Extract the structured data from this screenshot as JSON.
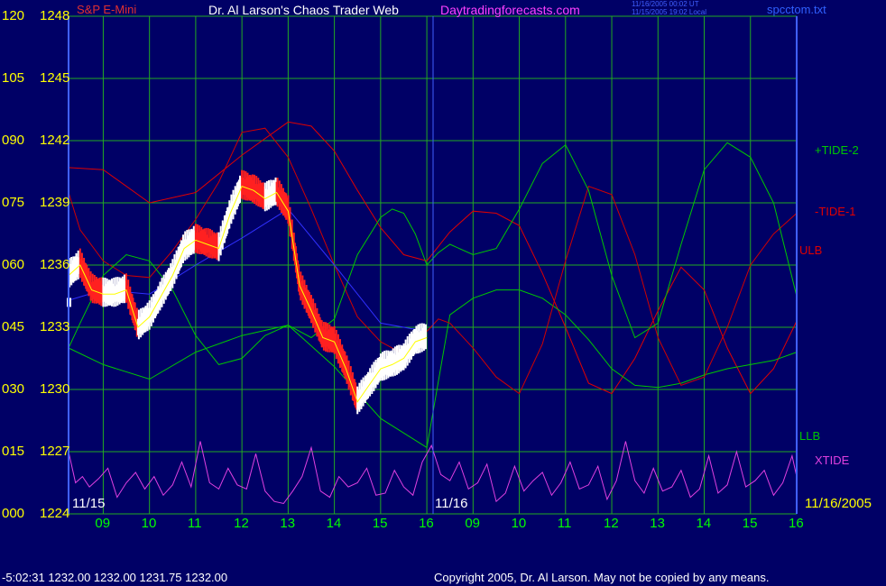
{
  "header": {
    "symbol": "S&P E-Mini",
    "title": "Dr. Al Larson's Chaos Trader Web",
    "site": "Daytradingforecasts.com",
    "stamp_line1": "11/16/2005 00:02 UT",
    "stamp_line2": "11/15/2005 19:02 Local",
    "file": "spcctom.txt"
  },
  "footer": {
    "readout": "-5:02:31  1232.00 1232.00 1231.75 1232.00",
    "copyright": "Copyright 2005, Dr. Al Larson. May not be copied by any means."
  },
  "colors": {
    "background": "#000066",
    "grid": "#22AA22",
    "axis_labels": "#FFFF00",
    "hour_labels": "#00FF00",
    "tide_plus": "#00C800",
    "tide_minus": "#D00000",
    "ulb": "#E00000",
    "llb": "#00C800",
    "xtide": "#E040E0",
    "moving_avg": "#3030FF",
    "price_up": "#FFFFFF",
    "price_down": "#FF2020",
    "price_line": "#FFFF00"
  },
  "chart_data": {
    "type": "line",
    "y_axis": {
      "range": [
        1224,
        1248
      ],
      "ticks": [
        {
          "left": "120",
          "right": "1248",
          "value": 1248
        },
        {
          "left": "105",
          "right": "1245",
          "value": 1245
        },
        {
          "left": "090",
          "right": "1242",
          "value": 1242
        },
        {
          "left": "075",
          "right": "1239",
          "value": 1239
        },
        {
          "left": "060",
          "right": "1236",
          "value": 1236
        },
        {
          "left": "045",
          "right": "1233",
          "value": 1233
        },
        {
          "left": "030",
          "right": "1230",
          "value": 1230
        },
        {
          "left": "015",
          "right": "1227",
          "value": 1227
        },
        {
          "left": "000",
          "right": "1224",
          "value": 1224
        }
      ]
    },
    "x_axis": {
      "hour_ticks": [
        "09",
        "10",
        "11",
        "12",
        "13",
        "14",
        "15",
        "16",
        "09",
        "10",
        "11",
        "12",
        "13",
        "14",
        "15",
        "16"
      ],
      "date_labels": [
        "11/15",
        "11/16",
        "11/16/2005"
      ]
    },
    "series_labels": [
      {
        "id": "tide_plus",
        "label": "+TIDE-2"
      },
      {
        "id": "tide_minus",
        "label": "-TIDE-1"
      },
      {
        "id": "ulb",
        "label": "ULB"
      },
      {
        "id": "llb",
        "label": "LLB"
      },
      {
        "id": "xtide",
        "label": "XTIDE"
      }
    ],
    "price": {
      "x": [
        8.25,
        8.5,
        8.75,
        9,
        9.25,
        9.5,
        9.75,
        10,
        10.25,
        10.5,
        10.75,
        11,
        11.25,
        11.5,
        11.75,
        12,
        12.25,
        12.5,
        12.75,
        13,
        13.25,
        13.5,
        13.75,
        14,
        14.25,
        14.5,
        14.75,
        15,
        15.25,
        15.5,
        15.75,
        16
      ],
      "y": [
        1235.5,
        1236,
        1234.8,
        1234.6,
        1234.6,
        1234.8,
        1233,
        1233.5,
        1234.5,
        1235.5,
        1236.8,
        1237.2,
        1237,
        1236.8,
        1238.5,
        1239.8,
        1239.6,
        1239.2,
        1239.5,
        1238.6,
        1235,
        1233.8,
        1232.5,
        1232.3,
        1231,
        1229.4,
        1230.2,
        1231,
        1231.2,
        1231.5,
        1232.3,
        1232.5
      ]
    },
    "moving_average": {
      "x": [
        8.25,
        9,
        10,
        11,
        12,
        13,
        14,
        15,
        16
      ],
      "y": [
        1234.3,
        1234.8,
        1234.6,
        1236,
        1237.3,
        1238.7,
        1236,
        1233.2,
        1232.8
      ]
    },
    "ulb": {
      "x": [
        8.25,
        9,
        10,
        11,
        12,
        13,
        13.5,
        14,
        14.5,
        15,
        15.5,
        16,
        16.5,
        17,
        17.5,
        18,
        18.5,
        19,
        19.5,
        20,
        20.5,
        21,
        21.5,
        22,
        22.5,
        23,
        23.5,
        24
      ],
      "y": [
        1240.7,
        1240.6,
        1239,
        1239.5,
        1241.3,
        1242.9,
        1242.7,
        1241.5,
        1239.6,
        1237.8,
        1236.5,
        1236.2,
        1237.6,
        1238.6,
        1238.5,
        1237.9,
        1235.6,
        1233,
        1230.3,
        1229.8,
        1231.5,
        1233.8,
        1235.9,
        1234.8,
        1232,
        1229.8,
        1231,
        1233.3
      ]
    },
    "llb": {
      "x": [
        8.25,
        9,
        10,
        11,
        12,
        13,
        14,
        15,
        16,
        16.5,
        17,
        17.5,
        18,
        18.5,
        19,
        19.5,
        20,
        20.5,
        21,
        21.5,
        22,
        22.5,
        23,
        23.5,
        24
      ],
      "y": [
        1232,
        1231.2,
        1230.5,
        1231.8,
        1232.6,
        1233.1,
        1231.1,
        1228.6,
        1227.2,
        1233.6,
        1234.4,
        1234.8,
        1234.8,
        1234.4,
        1233.6,
        1232.4,
        1231,
        1230.2,
        1230.1,
        1230.3,
        1230.7,
        1231,
        1231.2,
        1231.4,
        1231.8
      ]
    },
    "tide_plus": {
      "x": [
        8.25,
        8.5,
        9,
        9.5,
        10,
        10.5,
        11,
        11.5,
        12,
        12.5,
        13,
        13.5,
        14,
        14.5,
        15,
        15.25,
        15.5,
        15.75,
        16,
        16.25,
        16.5,
        17,
        17.5,
        18,
        18.5,
        19,
        19.5,
        20,
        20.5,
        21,
        21.5,
        22,
        22.5,
        23,
        23.5,
        24
      ],
      "y": [
        1232,
        1233.2,
        1235.5,
        1236.5,
        1236.2,
        1234.8,
        1232.6,
        1231.2,
        1231.5,
        1232.6,
        1233.1,
        1232.5,
        1233.4,
        1236.5,
        1238.3,
        1238.7,
        1238.5,
        1237.5,
        1236,
        1236.6,
        1237,
        1236.5,
        1236.8,
        1238.7,
        1240.9,
        1241.8,
        1239.6,
        1235.5,
        1232.5,
        1233.2,
        1237,
        1240.6,
        1241.9,
        1241.2,
        1239,
        1234.5
      ]
    },
    "tide_minus": {
      "x": [
        8.25,
        8.5,
        9,
        9.5,
        10,
        10.5,
        11,
        11.5,
        12,
        12.5,
        13,
        13.5,
        14,
        14.5,
        15,
        15.5,
        16,
        16.25,
        16.5,
        17,
        17.5,
        18,
        18.5,
        19,
        19.5,
        20,
        20.5,
        21,
        21.5,
        22,
        22.5,
        23,
        23.5,
        24
      ],
      "y": [
        1239.5,
        1237.7,
        1236.2,
        1235.5,
        1235.4,
        1236.7,
        1238.2,
        1240,
        1242.4,
        1242.6,
        1241.2,
        1238.7,
        1236,
        1233.5,
        1232.3,
        1231.7,
        1232.8,
        1233.4,
        1233.2,
        1232,
        1230.6,
        1229.8,
        1232.2,
        1236.2,
        1239.8,
        1239.4,
        1236.5,
        1232.5,
        1230.2,
        1230.6,
        1233,
        1236,
        1237.5,
        1238.5
      ]
    },
    "xtide": {
      "x": [
        8.25,
        8.4,
        8.55,
        8.7,
        8.9,
        9.1,
        9.3,
        9.5,
        9.7,
        9.9,
        10.1,
        10.3,
        10.5,
        10.7,
        10.9,
        11.1,
        11.3,
        11.5,
        11.7,
        11.9,
        12.1,
        12.3,
        12.5,
        12.7,
        12.9,
        13.1,
        13.3,
        13.5,
        13.7,
        13.9,
        14.1,
        14.3,
        14.5,
        14.7,
        14.9,
        15.1,
        15.3,
        15.5,
        15.7,
        15.9,
        16.1,
        16.3,
        16.5,
        16.7,
        16.9,
        17.1,
        17.3,
        17.5,
        17.7,
        17.9,
        18.1,
        18.3,
        18.5,
        18.7,
        18.9,
        19.1,
        19.3,
        19.5,
        19.7,
        19.9,
        20.1,
        20.3,
        20.5,
        20.7,
        20.9,
        21.1,
        21.3,
        21.5,
        21.7,
        21.9,
        22.1,
        22.3,
        22.5,
        22.7,
        22.9,
        23.1,
        23.3,
        23.5,
        23.7,
        23.9,
        24
      ],
      "y": [
        1227,
        1225.5,
        1225.8,
        1225.3,
        1225.7,
        1226.2,
        1224.8,
        1225.5,
        1226,
        1225.2,
        1225.8,
        1224.9,
        1225.4,
        1226.5,
        1225.3,
        1227.5,
        1225.5,
        1225.2,
        1226.2,
        1225.4,
        1225.2,
        1226.9,
        1225.1,
        1224.6,
        1224.5,
        1225.1,
        1225.8,
        1227.2,
        1225.1,
        1224.8,
        1225.8,
        1225.3,
        1225.5,
        1226.2,
        1224.9,
        1225,
        1226.1,
        1225.3,
        1224.9,
        1226.5,
        1227.3,
        1225.9,
        1225.6,
        1226.5,
        1225.2,
        1225.5,
        1226.4,
        1224.6,
        1225,
        1226.3,
        1225.1,
        1225.6,
        1226,
        1224.9,
        1225.5,
        1226.5,
        1225.2,
        1225.4,
        1226.3,
        1224.7,
        1225.6,
        1227.5,
        1225.6,
        1225,
        1226.2,
        1225.1,
        1225.3,
        1226.1,
        1224.8,
        1225.2,
        1226.8,
        1225,
        1225.4,
        1227,
        1225.3,
        1225.6,
        1226.1,
        1224.9,
        1225.5,
        1226.8,
        1225.8
      ]
    }
  }
}
